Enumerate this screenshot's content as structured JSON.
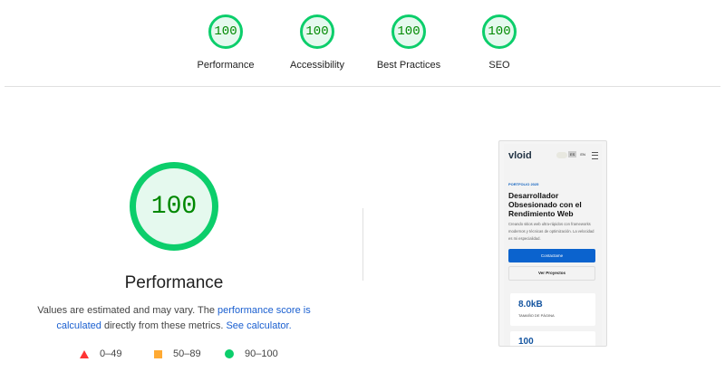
{
  "categories": [
    {
      "label": "Performance",
      "score": "100"
    },
    {
      "label": "Accessibility",
      "score": "100"
    },
    {
      "label": "Best Practices",
      "score": "100"
    },
    {
      "label": "SEO",
      "score": "100"
    }
  ],
  "main": {
    "score": "100",
    "title": "Performance",
    "desc_prefix": "Values are estimated and may vary. The ",
    "link1": "performance score is calculated",
    "desc_mid": " directly from these metrics. ",
    "link2": "See calculator.",
    "legend": [
      {
        "range": "0–49",
        "color": "#ff3333"
      },
      {
        "range": "50–89",
        "color": "#ffaa33"
      },
      {
        "range": "90–100",
        "color": "#0cce6b"
      }
    ]
  },
  "screenshot": {
    "logo": "vloid",
    "lang": [
      "ES",
      "EN"
    ],
    "eyebrow": "PORTFOLIO 2025",
    "heading": "Desarrollador Obsesionado con el Rendimiento Web",
    "body": "Creando sitios web ultra-rápidos con frameworks modernos y técnicas de optimización. La velocidad es mi especialidad.",
    "primary": "Contactame",
    "secondary": "Ver Proyectos",
    "stat1_value": "8.0kB",
    "stat1_label": "TAMAÑO DE PÁGINA",
    "stat2_value": "100"
  }
}
